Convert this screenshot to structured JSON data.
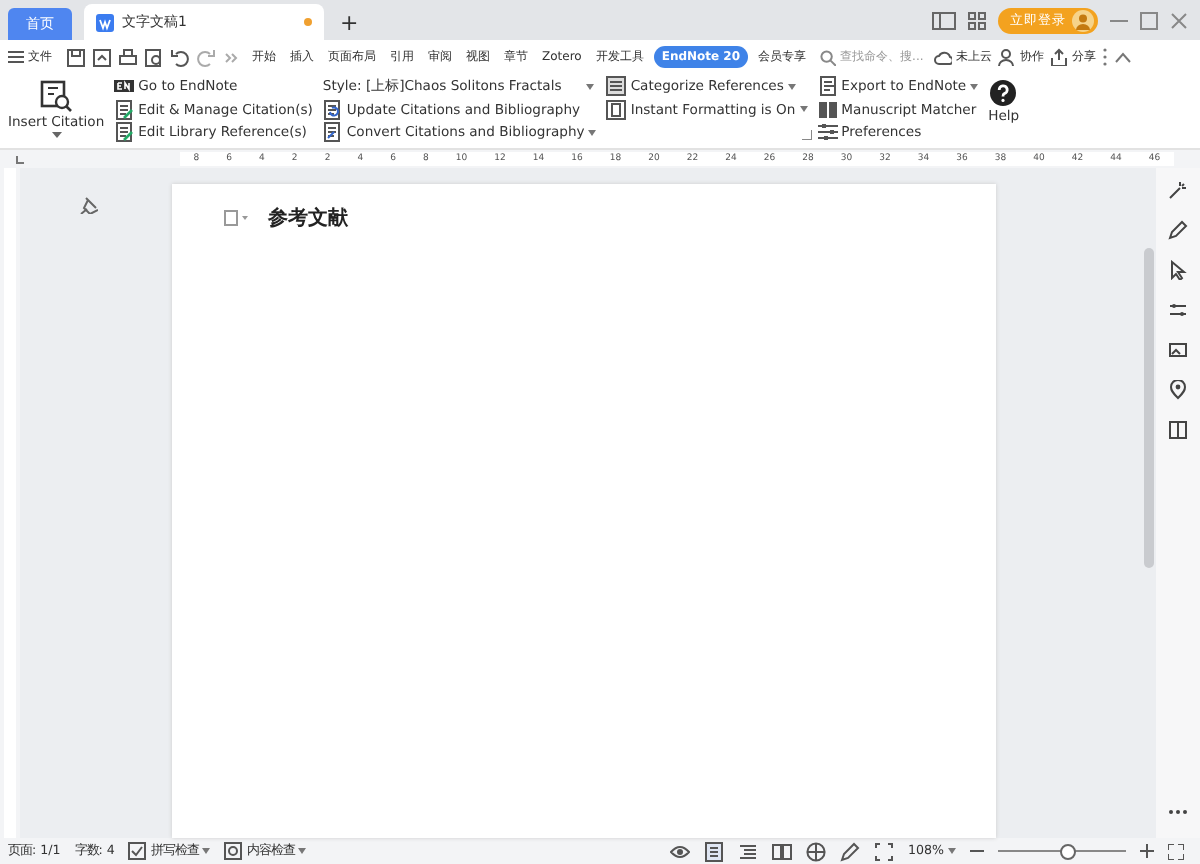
{
  "title_bar": {
    "home_tab": "首页",
    "doc_tab": {
      "title": "文字文稿1",
      "unsaved": true
    },
    "new_tab": "+",
    "login": "立即登录"
  },
  "menu": {
    "file": "文件",
    "tabs": [
      {
        "label": "开始",
        "selected": false
      },
      {
        "label": "插入",
        "selected": false
      },
      {
        "label": "页面布局",
        "selected": false
      },
      {
        "label": "引用",
        "selected": false
      },
      {
        "label": "审阅",
        "selected": false
      },
      {
        "label": "视图",
        "selected": false
      },
      {
        "label": "章节",
        "selected": false
      },
      {
        "label": "Zotero",
        "selected": false
      },
      {
        "label": "开发工具",
        "selected": false
      },
      {
        "label": "EndNote 20",
        "selected": true
      },
      {
        "label": "会员专享",
        "selected": false
      }
    ],
    "search": {
      "placeholder": "查找命令、搜..."
    },
    "actions": [
      "未上云",
      "协作",
      "分享"
    ]
  },
  "ribbon": {
    "insert_citation": "Insert Citation",
    "col1": [
      "Go to EndNote",
      "Edit & Manage Citation(s)",
      "Edit Library Reference(s)"
    ],
    "style": "Style: [上标]Chaos Solitons Fractals",
    "col2": [
      "Update Citations and Bibliography",
      "Convert Citations and Bibliography"
    ],
    "col3": [
      "Categorize References",
      "Instant Formatting is On"
    ],
    "col4": [
      "Export to EndNote",
      "Manuscript Matcher",
      "Preferences"
    ],
    "help": "Help"
  },
  "ruler": [
    "8",
    "6",
    "4",
    "2",
    "2",
    "4",
    "6",
    "8",
    "10",
    "12",
    "14",
    "16",
    "18",
    "20",
    "22",
    "24",
    "26",
    "28",
    "30",
    "32",
    "34",
    "36",
    "38",
    "40",
    "42",
    "44",
    "46"
  ],
  "document": {
    "heading": "参考文献"
  },
  "status_bar": {
    "page": "页面: 1/1",
    "words": "字数: 4",
    "spell": "拼写检查",
    "content": "内容检查",
    "zoom": "108%",
    "zoom_slider": {
      "level": 0.55
    }
  }
}
